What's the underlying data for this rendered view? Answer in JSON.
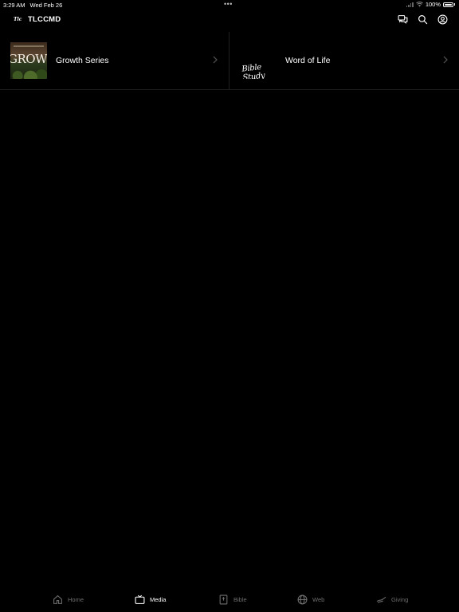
{
  "status_bar": {
    "time": "3:29 AM",
    "date": "Wed Feb 26",
    "dots": "•••",
    "battery": "100%"
  },
  "header": {
    "logo_text": "Tlc",
    "title": "TLCCMD",
    "icons": [
      "chat-icon",
      "search-icon",
      "profile-icon"
    ]
  },
  "series": [
    {
      "label": "Growth Series",
      "thumb_text": "GROWTH"
    },
    {
      "label": "Word of Life",
      "thumb_text": "Bible Study"
    }
  ],
  "tabs": [
    {
      "label": "Home",
      "icon": "home-icon",
      "active": false
    },
    {
      "label": "Media",
      "icon": "tv-icon",
      "active": true
    },
    {
      "label": "Bible",
      "icon": "bible-icon",
      "active": false
    },
    {
      "label": "Web",
      "icon": "globe-icon",
      "active": false
    },
    {
      "label": "Giving",
      "icon": "giving-icon",
      "active": false
    }
  ],
  "colors": {
    "background": "#000000",
    "active_tab": "#ffffff",
    "inactive_tab": "#6e6e6e",
    "divider": "#1e1e1e"
  }
}
